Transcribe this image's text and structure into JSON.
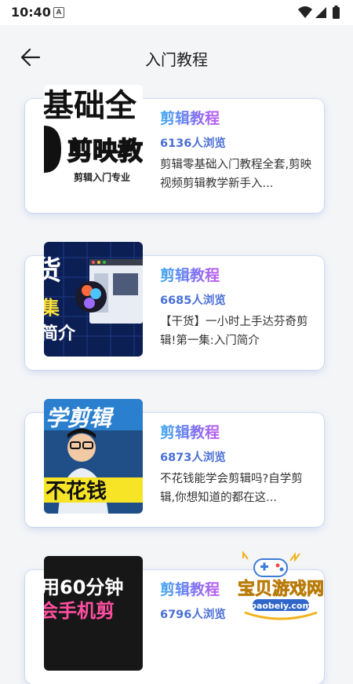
{
  "status_bar": {
    "time": "10:40",
    "notification_glyph": "A"
  },
  "header": {
    "title": "入门教程",
    "back_icon": "arrow-left-icon"
  },
  "cards": [
    {
      "title": "剪辑教程",
      "views": "6136人浏览",
      "desc": "剪辑零基础入门教程全套,剪映视频剪辑教学新手入...",
      "thumb": {
        "line1": "基础全",
        "line2": "剪映教",
        "line3": "剪辑入门专业"
      }
    },
    {
      "title": "剪辑教程",
      "views": "6685人浏览",
      "desc": "【干货】一小时上手达芬奇剪辑!第一集:入门简介",
      "thumb": {
        "line1": "货",
        "line2": "集",
        "line3": "简介"
      }
    },
    {
      "title": "剪辑教程",
      "views": "6873人浏览",
      "desc": "不花钱能学会剪辑吗?自学剪辑,你想知道的都在这...",
      "thumb": {
        "line1": "学剪辑",
        "line2": "不花钱"
      }
    },
    {
      "title": "剪辑教程",
      "views": "6796人浏览",
      "desc": "",
      "thumb": {
        "line1": "用60分钟",
        "line2": "会手机剪"
      }
    }
  ],
  "watermark": {
    "name": "宝贝游戏网",
    "url": "baobeiy.com"
  },
  "colors": {
    "accent_start": "#39a7f0",
    "accent_end": "#c05cf0",
    "views": "#4a6fd6"
  }
}
